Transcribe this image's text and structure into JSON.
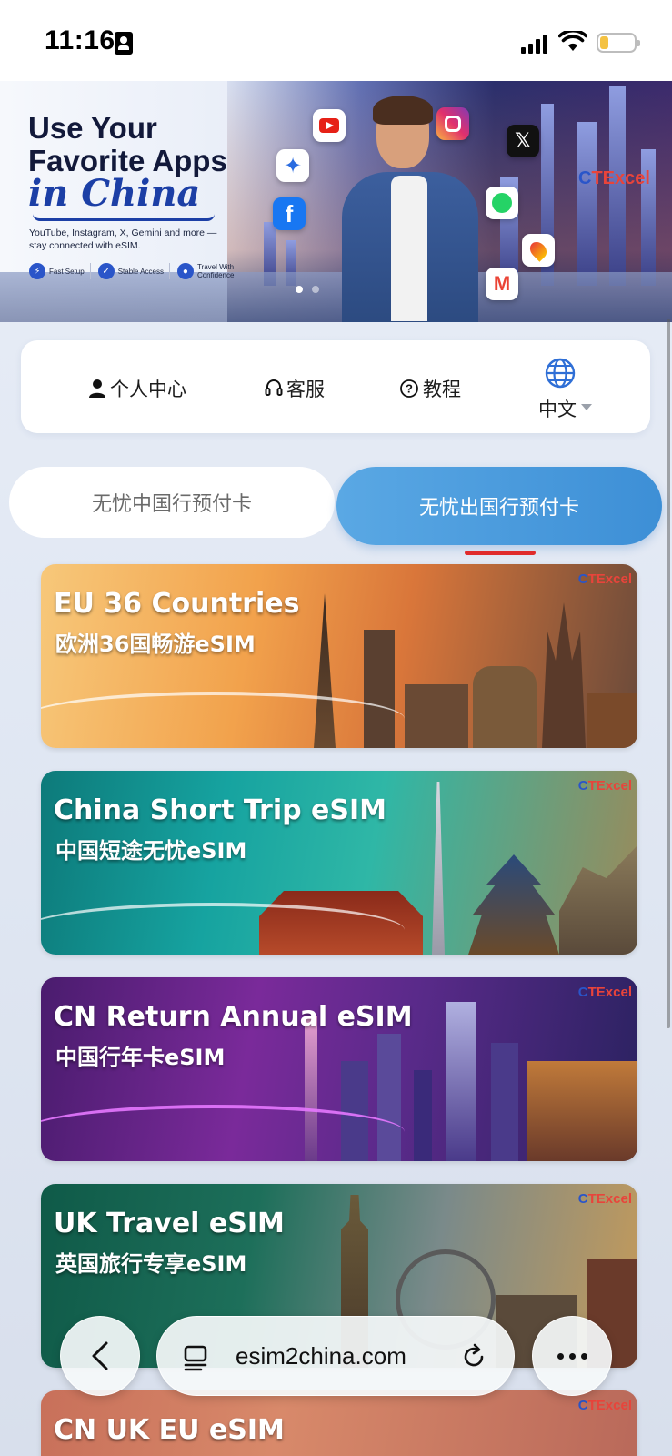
{
  "status_bar": {
    "time": "11:16",
    "icons": [
      "id-card-icon",
      "cellular-signal-icon",
      "wifi-icon",
      "battery-low-icon"
    ]
  },
  "hero": {
    "title": "Use Your Favorite Apps",
    "title_script": "in China",
    "subtitle": "YouTube, Instagram, X, Gemini and more — stay connected with eSIM.",
    "features": [
      {
        "icon": "lightning-icon",
        "label": "Fast Setup"
      },
      {
        "icon": "shield-icon",
        "label": "Stable Access"
      },
      {
        "icon": "location-pin-icon",
        "label": "Travel With Confidence"
      }
    ],
    "logo_c": "C",
    "logo_rest": "TExcel",
    "app_icons": [
      "youtube-icon",
      "instagram-icon",
      "x-icon",
      "gemini-icon",
      "facebook-icon",
      "whatsapp-icon",
      "google-maps-icon",
      "gmail-icon"
    ],
    "carousel_pages": 2,
    "carousel_active": 0
  },
  "nav": {
    "personal_center": "个人中心",
    "customer_service": "客服",
    "tutorial": "教程",
    "language": "中文"
  },
  "tabs": {
    "inactive_label": "无忧中国行预付卡",
    "active_label": "无忧出国行预付卡"
  },
  "cards": [
    {
      "title": "EU 36 Countries",
      "subtitle": "欧洲36国畅游eSIM"
    },
    {
      "title": "China Short Trip eSIM",
      "subtitle": "中国短途无忧eSIM"
    },
    {
      "title": "CN Return Annual eSIM",
      "subtitle": "中国行年卡eSIM"
    },
    {
      "title": "UK Travel eSIM",
      "subtitle": "英国旅行专享eSIM"
    },
    {
      "title": "CN UK EU eSIM",
      "subtitle": ""
    }
  ],
  "card_logo": {
    "c": "C",
    "rest": "TExcel"
  },
  "browser": {
    "url": "esim2china.com"
  },
  "colors": {
    "active_tab": "#3d8fd6",
    "tab_underline": "#e02b2b",
    "brand_red": "#e8443b",
    "brand_blue": "#2a55c9"
  }
}
